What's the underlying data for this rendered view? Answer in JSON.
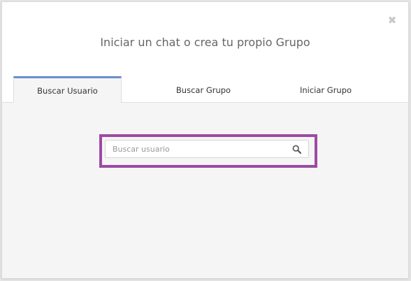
{
  "modal": {
    "close_glyph": "✖",
    "title": "Iniciar un chat o crea tu propio Grupo"
  },
  "tabs": [
    {
      "label": "Buscar Usuario",
      "active": true
    },
    {
      "label": "Buscar Grupo",
      "active": false
    },
    {
      "label": "Iniciar Grupo",
      "active": false
    }
  ],
  "search": {
    "value": "",
    "placeholder": "Buscar usuario",
    "icon": "search-icon"
  },
  "colors": {
    "active_tab_accent": "#6a8fc9",
    "highlight_frame": "#9d4aa5"
  }
}
